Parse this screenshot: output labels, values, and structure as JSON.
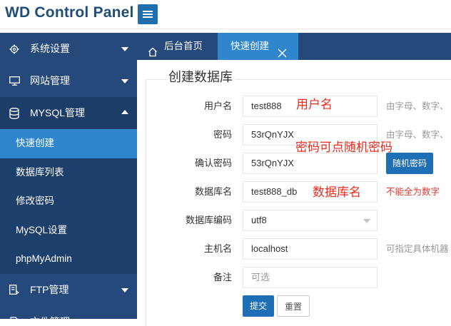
{
  "app": {
    "title": "WD Control Panel"
  },
  "sidebar": {
    "items": [
      {
        "label": "系统设置",
        "icon": "gear-icon"
      },
      {
        "label": "网站管理",
        "icon": "monitor-icon"
      },
      {
        "label": "MYSQL管理",
        "icon": "database-icon"
      },
      {
        "label": "FTP管理",
        "icon": "ftp-icon"
      },
      {
        "label": "文件管理",
        "icon": "file-icon"
      }
    ],
    "mysql_subitems": [
      "快速创建",
      "数据库列表",
      "修改密码",
      "MySQL设置",
      "phpMyAdmin"
    ]
  },
  "tabs": {
    "home": "后台首页",
    "quick_create": "快速创建"
  },
  "form": {
    "legend": "创建数据库",
    "username": {
      "label": "用户名",
      "value": "test888",
      "hint": "由字母、数字、"
    },
    "password": {
      "label": "密码",
      "value": "53rQnYJX",
      "hint": "由字母、数字、"
    },
    "confirm_password": {
      "label": "确认密码",
      "value": "53rQnYJX",
      "random_button": "随机密码"
    },
    "db_name": {
      "label": "数据库名",
      "value": "test888_db",
      "hint": "不能全为数字"
    },
    "db_encoding": {
      "label": "数据库编码",
      "value": "utf8"
    },
    "host": {
      "label": "主机名",
      "value": "localhost",
      "hint": "可指定具体机器"
    },
    "note": {
      "label": "备注",
      "placeholder": "可选"
    },
    "submit": "提交",
    "reset": "重置"
  },
  "annotations": {
    "username": "用户名",
    "password": "密码可点随机密码",
    "db_name": "数据库名"
  },
  "colors": {
    "sidebar_bg": "#24497a",
    "active_blue": "#2f86cc",
    "primary_button": "#1e6fb5",
    "annotation_red": "#ef2a1c",
    "logo": "#1f4e79"
  }
}
